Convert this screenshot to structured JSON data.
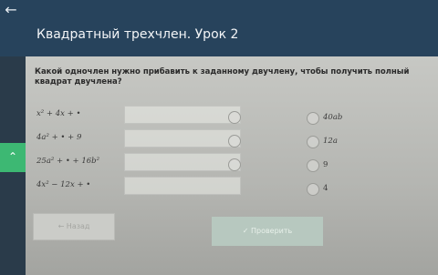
{
  "header": {
    "title": "Квадратный трехчлен. Урок 2"
  },
  "question": {
    "text": "Какой одночлен нужно прибавить к заданному двучлену, чтобы получить полный квадрат двучлена?"
  },
  "rows": [
    {
      "expr": "x² + 4x + •"
    },
    {
      "expr": "4a² + • + 9"
    },
    {
      "expr": "25a² + • + 16b²"
    },
    {
      "expr": "4x² − 12x + •"
    }
  ],
  "answers": [
    "40ab",
    "12a",
    "9",
    "4"
  ],
  "buttons": {
    "back": "← Назад",
    "check": "✓ Проверить"
  },
  "colors": {
    "header": "#27435c",
    "accent": "#3db873"
  },
  "icons": {
    "back": "arrow-left-icon",
    "collapse": "chevron-up-icon"
  }
}
